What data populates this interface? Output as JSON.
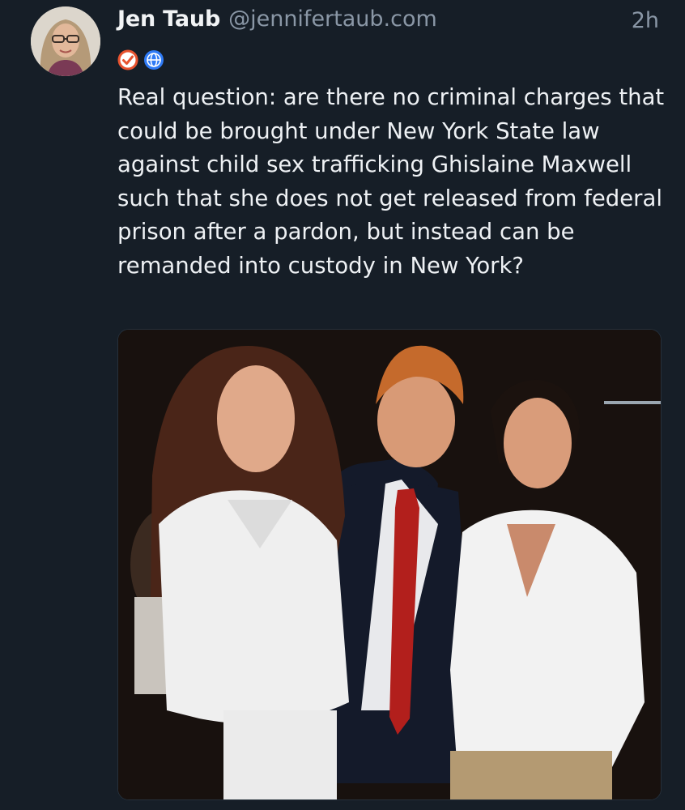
{
  "post": {
    "author": {
      "display_name": "Jen Taub",
      "handle": "@jennifertaub.com",
      "avatar_icon": "profile-photo-avatar"
    },
    "timestamp": "2h",
    "badges": [
      {
        "icon": "verified-check-icon",
        "color": "#e8532f"
      },
      {
        "icon": "globe-icon",
        "color": "#2f7bf6"
      }
    ],
    "text": "Real question: are there no criminal charges that could be brought under New York State law against child sex trafficking Ghislaine Maxwell such that she does not get released from federal prison after a pardon, but instead can be remanded into custody in New York?",
    "media": {
      "type": "photo",
      "icon": "embedded-photo"
    }
  },
  "colors": {
    "background": "#161e27",
    "text_primary": "#eef1f4",
    "text_secondary": "#8a97a6"
  }
}
